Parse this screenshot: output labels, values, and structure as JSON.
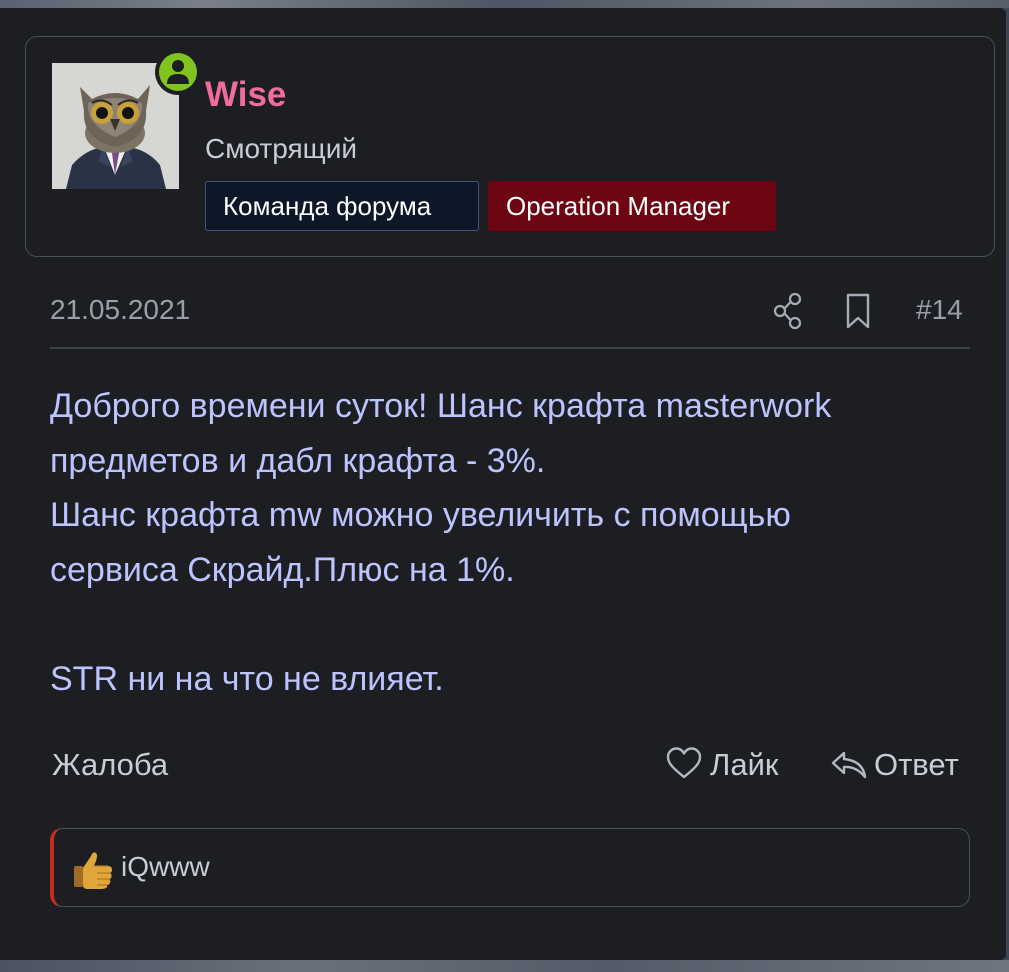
{
  "author": {
    "username": "Wise",
    "title": "Смотрящий",
    "banners": [
      "Команда форума",
      "Operation Manager"
    ],
    "status": "online",
    "avatar_icon": "owl-in-suit-avatar",
    "username_color": "#ef6d9c"
  },
  "post": {
    "date": "21.05.2021",
    "number": "#14",
    "body": [
      "Доброго времени суток! Шанс крафта masterwork",
      "предметов и дабл крафта - 3%.",
      "Шанс крафта mw можно увеличить с помощью",
      "сервиса Скрайд.Плюс на 1%.",
      "",
      "STR ни на что не влияет."
    ],
    "text_color": "#bcc3ff"
  },
  "actions": {
    "report": "Жалоба",
    "like": "Лайк",
    "reply": "Ответ"
  },
  "reactions": {
    "user": "iQwww",
    "icon": "thumbs-up-emoji"
  },
  "colors": {
    "panel_bg": "#1c1e22",
    "role_banner": "#6b0612",
    "team_banner": "#0d1728",
    "online": "#7fc41f",
    "reaction_accent": "#c22d1f"
  }
}
